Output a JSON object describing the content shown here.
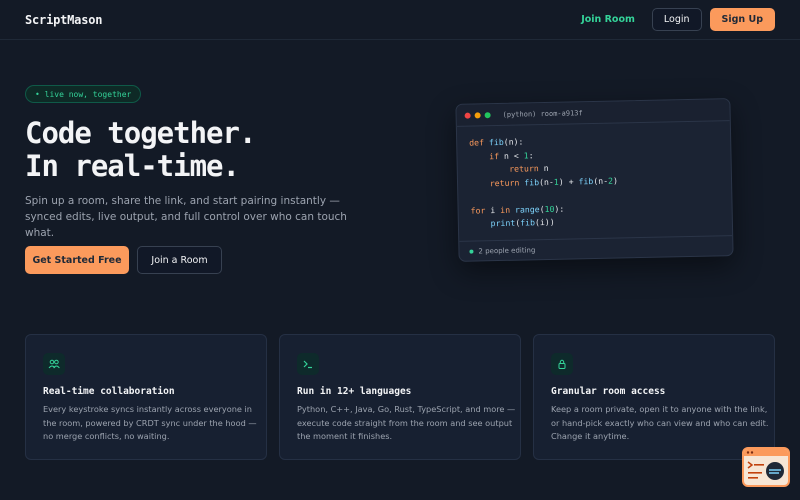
{
  "header": {
    "logo": "ScriptMason",
    "join_room": "Join Room",
    "login": "Login",
    "signup": "Sign Up"
  },
  "hero": {
    "badge": "• live now, together",
    "title_line1": "Code together.",
    "title_line2": "In real-time.",
    "description": "Spin up a room, share the link, and start pairing instantly — synced edits, live output, and full control over who can touch what.",
    "primary_cta": "Get Started Free",
    "secondary_cta": "Join a Room"
  },
  "editor": {
    "title": "(python) room-a913f",
    "footer": "2 people editing",
    "code_lines": [
      "def fib(n):",
      "    if n < 1:",
      "        return n",
      "    return fib(n-1) + fib(n-2)",
      "",
      "for i in range(10):",
      "    print(fib(i))"
    ]
  },
  "features": [
    {
      "icon": "users-icon",
      "title": "Real-time collaboration",
      "text": "Every keystroke syncs instantly across everyone in the room, powered by CRDT sync under the hood — no merge conflicts, no waiting."
    },
    {
      "icon": "terminal-icon",
      "title": "Run in 12+ languages",
      "text": "Python, C++, Java, Go, Rust, TypeScript, and more — execute code straight from the room and see output the moment it finishes."
    },
    {
      "icon": "lock-icon",
      "title": "Granular room access",
      "text": "Keep a room private, open it to anyone with the link, or hand-pick exactly who can view and who can edit. Change it anytime."
    }
  ],
  "colors": {
    "accent": "#fb9a5c",
    "green": "#34d399",
    "background": "#131a26"
  }
}
